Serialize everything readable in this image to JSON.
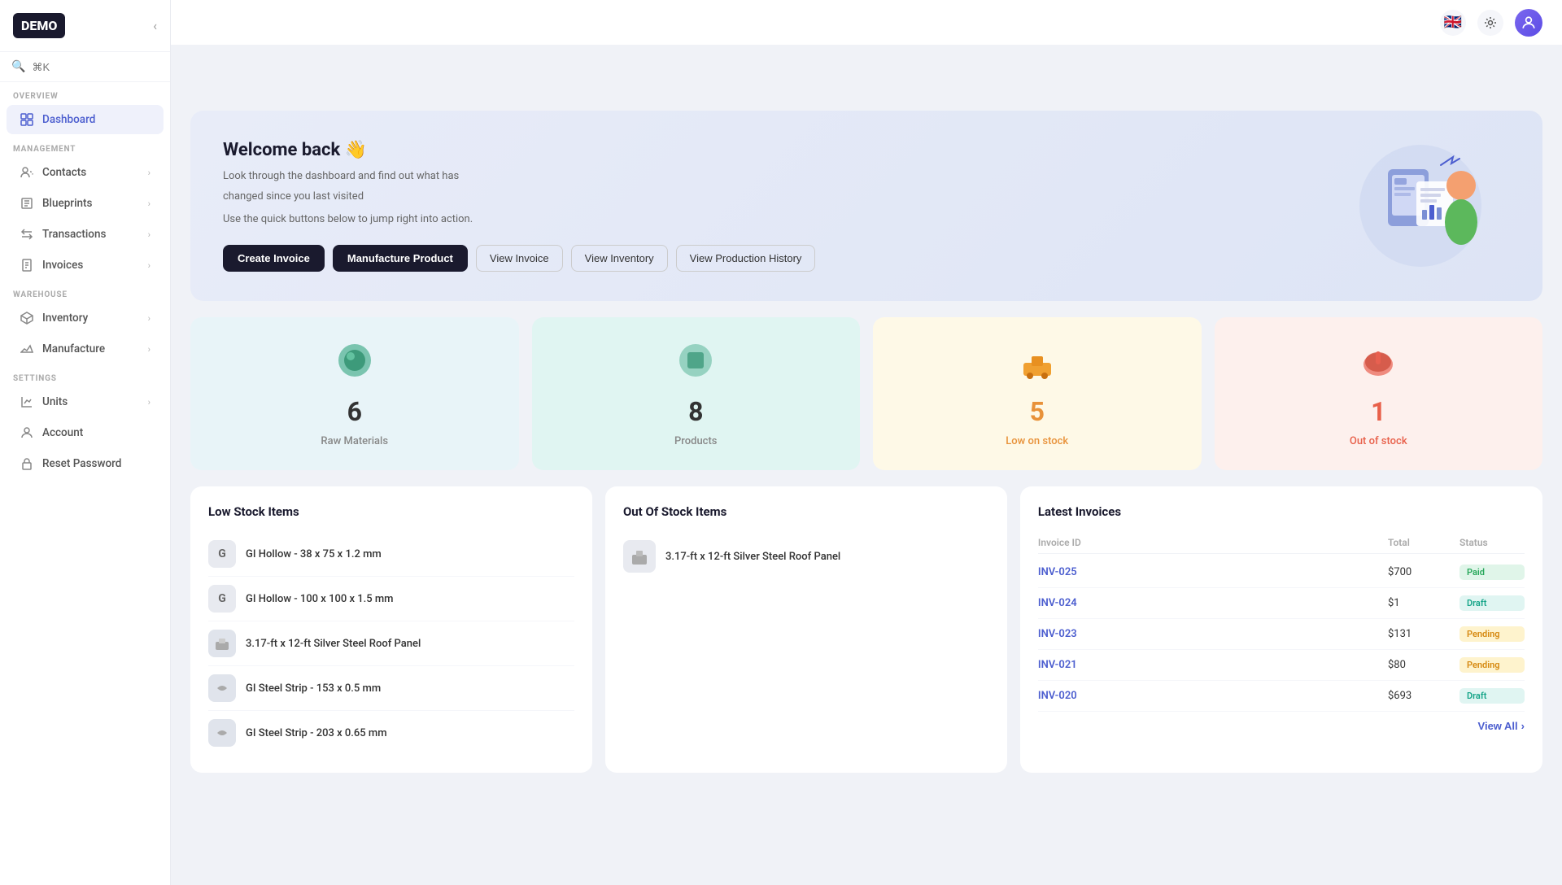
{
  "app": {
    "logo": "DEMO"
  },
  "search": {
    "placeholder": "⌘K"
  },
  "sidebar": {
    "sections": [
      {
        "label": "OVERVIEW",
        "items": [
          {
            "id": "dashboard",
            "label": "Dashboard",
            "icon": "grid",
            "active": true,
            "hasChevron": false
          }
        ]
      },
      {
        "label": "MANAGEMENT",
        "items": [
          {
            "id": "contacts",
            "label": "Contacts",
            "icon": "users",
            "active": false,
            "hasChevron": true
          },
          {
            "id": "blueprints",
            "label": "Blueprints",
            "icon": "blueprint",
            "active": false,
            "hasChevron": true
          },
          {
            "id": "transactions",
            "label": "Transactions",
            "icon": "transaction",
            "active": false,
            "hasChevron": true
          },
          {
            "id": "invoices",
            "label": "Invoices",
            "icon": "invoice",
            "active": false,
            "hasChevron": true
          }
        ]
      },
      {
        "label": "WAREHOUSE",
        "items": [
          {
            "id": "inventory",
            "label": "Inventory",
            "icon": "inventory",
            "active": false,
            "hasChevron": true
          },
          {
            "id": "manufacture",
            "label": "Manufacture",
            "icon": "manufacture",
            "active": false,
            "hasChevron": true
          }
        ]
      },
      {
        "label": "SETTINGS",
        "items": [
          {
            "id": "units",
            "label": "Units",
            "icon": "units",
            "active": false,
            "hasChevron": true
          },
          {
            "id": "account",
            "label": "Account",
            "icon": "account",
            "active": false,
            "hasChevron": false
          },
          {
            "id": "reset-password",
            "label": "Reset Password",
            "icon": "lock",
            "active": false,
            "hasChevron": false
          }
        ]
      }
    ]
  },
  "banner": {
    "title": "Welcome back 👋",
    "subtitle1": "Look through the dashboard and find out what has",
    "subtitle2": "changed since you last visited",
    "subtitle3": "Use the quick buttons below to jump right into action.",
    "buttons": {
      "create_invoice": "Create Invoice",
      "manufacture_product": "Manufacture Product",
      "view_invoice": "View Invoice",
      "view_inventory": "View Inventory",
      "view_production_history": "View Production History"
    }
  },
  "stats": [
    {
      "id": "raw-materials",
      "number": "6",
      "label": "Raw Materials",
      "color": "blue",
      "icon": "🪨"
    },
    {
      "id": "products",
      "number": "8",
      "label": "Products",
      "color": "teal",
      "icon": "📦"
    },
    {
      "id": "low-on-stock",
      "number": "5",
      "label": "Low on stock",
      "color": "yellow",
      "icon": "🛒",
      "accent": "orange"
    },
    {
      "id": "out-of-stock",
      "number": "1",
      "label": "Out of stock",
      "color": "peach",
      "icon": "🚫",
      "accent": "red"
    }
  ],
  "low_stock": {
    "title": "Low Stock Items",
    "items": [
      {
        "id": "gi-hollow-1",
        "avatar": "G",
        "name": "GI Hollow - 38 x 75 x 1.2 mm",
        "type": "text"
      },
      {
        "id": "gi-hollow-2",
        "avatar": "G",
        "name": "GI Hollow - 100 x 100 x 1.5 mm",
        "type": "text"
      },
      {
        "id": "roof-panel",
        "avatar": "🔩",
        "name": "3.17-ft x 12-ft Silver Steel Roof Panel",
        "type": "icon"
      },
      {
        "id": "steel-strip-1",
        "avatar": "⚙",
        "name": "GI Steel Strip - 153 x 0.5 mm",
        "type": "icon"
      },
      {
        "id": "steel-strip-2",
        "avatar": "⚙",
        "name": "GI Steel Strip - 203 x 0.65 mm",
        "type": "icon"
      }
    ]
  },
  "out_of_stock": {
    "title": "Out Of Stock Items",
    "items": [
      {
        "id": "roof-panel-out",
        "avatar": "🔩",
        "name": "3.17-ft x 12-ft Silver Steel Roof Panel"
      }
    ]
  },
  "invoices": {
    "title": "Latest Invoices",
    "columns": {
      "id": "Invoice ID",
      "total": "Total",
      "status": "Status"
    },
    "rows": [
      {
        "id": "INV-025",
        "total": "$700",
        "status": "Paid",
        "status_type": "paid"
      },
      {
        "id": "INV-024",
        "total": "$1",
        "status": "Draft",
        "status_type": "draft"
      },
      {
        "id": "INV-023",
        "total": "$131",
        "status": "Pending",
        "status_type": "pending"
      },
      {
        "id": "INV-021",
        "total": "$80",
        "status": "Pending",
        "status_type": "pending"
      },
      {
        "id": "INV-020",
        "total": "$693",
        "status": "Draft",
        "status_type": "draft"
      }
    ],
    "view_all": "View All"
  }
}
